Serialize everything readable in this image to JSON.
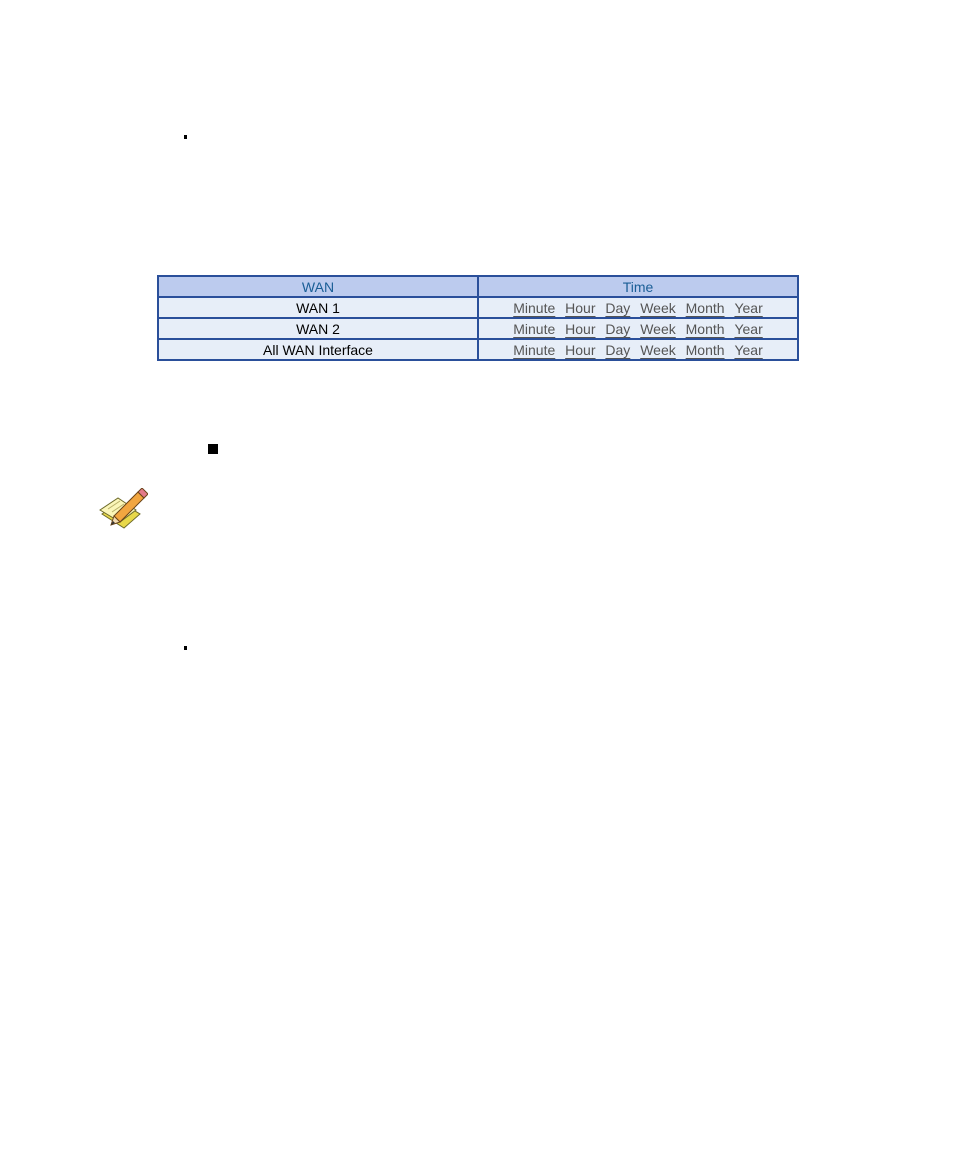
{
  "table": {
    "headers": {
      "wan": "WAN",
      "time": "Time"
    },
    "rows": [
      {
        "wan": "WAN 1",
        "links": [
          "Minute",
          "Hour",
          "Day",
          "Week",
          "Month",
          "Year"
        ]
      },
      {
        "wan": "WAN 2",
        "links": [
          "Minute",
          "Hour",
          "Day",
          "Week",
          "Month",
          "Year"
        ]
      },
      {
        "wan": "All WAN Interface",
        "links": [
          "Minute",
          "Hour",
          "Day",
          "Week",
          "Month",
          "Year"
        ]
      }
    ]
  },
  "icons": {
    "note": "note-pencil-icon",
    "bullet": "bullet-dot",
    "square_bullet": "square-bullet"
  },
  "colors": {
    "border": "#2a4f9a",
    "header_bg": "#bccbee",
    "header_text": "#1a5e96",
    "row_bg": "#e7eef8",
    "link_text": "#555555"
  }
}
